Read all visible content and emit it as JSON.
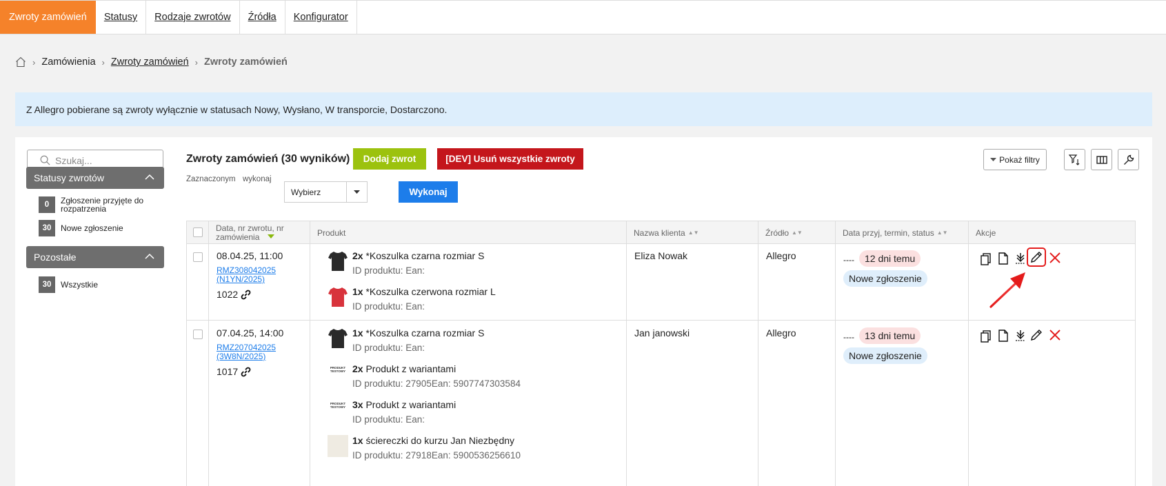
{
  "topnav": {
    "tabs": [
      {
        "label": "Zwroty zamówień",
        "active": true
      },
      {
        "label": "Statusy"
      },
      {
        "label": "Rodzaje zwrotów"
      },
      {
        "label": "Źródła"
      },
      {
        "label": "Konfigurator"
      }
    ]
  },
  "breadcrumb": {
    "items": [
      "Zamówienia",
      "Zwroty zamówień",
      "Zwroty zamówień"
    ]
  },
  "info_banner": "Z Allegro pobierane są zwroty wyłącznie w statusach Nowy, Wysłano, W transporcie, Dostarczono.",
  "sidebar": {
    "search_placeholder": "Szukaj...",
    "sections": [
      {
        "title": "Statusy zwrotów",
        "items": [
          {
            "count": "0",
            "label": "Zgłoszenie przyjęte do rozpatrzenia"
          },
          {
            "count": "30",
            "label": "Nowe zgłoszenie"
          }
        ]
      },
      {
        "title": "Pozostałe",
        "items": [
          {
            "count": "30",
            "label": "Wszystkie"
          }
        ]
      }
    ]
  },
  "toolbar": {
    "title": "Zwroty zamówień (30 wyników)",
    "add_label": "Dodaj zwrot",
    "delete_all_label": "[DEV] Usuń wszystkie zwroty",
    "filters_label": "Pokaż filtry",
    "bulk_label_1": "Zaznaczonym",
    "bulk_label_2": "wykonaj",
    "select_value": "Wybierz",
    "execute_label": "Wykonaj"
  },
  "table": {
    "columns": [
      "Data, nr zwrotu, nr zamówienia",
      "Produkt",
      "Nazwa klienta",
      "Źródło",
      "Data przyj, termin, status",
      "Akcje"
    ],
    "rows": [
      {
        "date": "08.04.25, 11:00",
        "rma_line1": "RMZ308042025",
        "rma_line2": "(N1YN/2025)",
        "order_no": "1022",
        "products": [
          {
            "qty": "2x",
            "name": "*Koszulka czarna rozmiar S",
            "pid": "ID produktu: Ean:",
            "thumb": "tshirt-black"
          },
          {
            "qty": "1x",
            "name": "*Koszulka czerwona rozmiar L",
            "pid": "ID produktu: Ean:",
            "thumb": "tshirt-red"
          }
        ],
        "client": "Eliza Nowak",
        "source": "Allegro",
        "dash": "----",
        "days": "12 dni temu",
        "status": "Nowe zgłoszenie"
      },
      {
        "date": "07.04.25, 14:00",
        "rma_line1": "RMZ207042025",
        "rma_line2": "(3W8N/2025)",
        "order_no": "1017",
        "products": [
          {
            "qty": "1x",
            "name": "*Koszulka czarna rozmiar S",
            "pid": "ID produktu: Ean:",
            "thumb": "tshirt-black"
          },
          {
            "qty": "2x",
            "name": "Produkt z wariantami",
            "pid": "ID produktu: 27905Ean: 5907747303584",
            "thumb": "produkt-testowy"
          },
          {
            "qty": "3x",
            "name": "Produkt z wariantami",
            "pid": "ID produktu: Ean:",
            "thumb": "produkt-testowy"
          },
          {
            "qty": "1x",
            "name": "ściereczki do kurzu Jan Niezbędny",
            "pid": "ID produktu: 27918Ean: 5900536256610",
            "thumb": "beige-square"
          }
        ],
        "client": "Jan janowski",
        "source": "Allegro",
        "dash": "----",
        "days": "13 dni temu",
        "status": "Nowe zgłoszenie"
      }
    ]
  },
  "thumb_text": "PRODUKT TESTOWY",
  "colors": {
    "accent_orange": "#f5822a",
    "add_green": "#9cc20e",
    "delete_red": "#c4161c",
    "exec_blue": "#1d7dea",
    "highlight_red": "#e41b1b"
  },
  "icons": [
    "home-icon",
    "search-icon",
    "chevron-up-icon",
    "filter-sort-icon",
    "columns-icon",
    "wrench-icon",
    "copy-icon",
    "document-icon",
    "download-icon",
    "pencil-icon",
    "close-icon",
    "link-icon",
    "annotation-arrow"
  ]
}
